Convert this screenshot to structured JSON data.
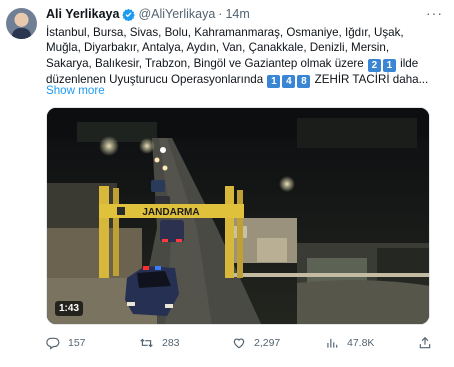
{
  "tweet": {
    "author_name": "Ali Yerlikaya",
    "handle": "@AliYerlikaya",
    "separator": "·",
    "time": "14m",
    "verified_icon": "verified-badge-icon",
    "lines": {
      "line1": "İstanbul, Bursa, Sivas, Bolu, Kahramanmaraş, Osmaniye, Iğdır, Uşak,",
      "line2": "Muğla, Diyarbakır, Antalya, Aydın, Van, Çanakkale, Denizli, Mersin,",
      "line3_pre": "Sakarya, Balıkesir, Trabzon, Bingöl ve Gaziantep  olmak üzere ",
      "line3_box1": "2",
      "line3_box2": "1",
      "line3_post": " ilde",
      "line4_pre": "düzenlenen Uyuşturucu Operasyonlarında ",
      "line4_box1": "1",
      "line4_box2": "4",
      "line4_box3": "8",
      "line4_post": " ZEHİR TACİRİ daha..."
    },
    "show_more": "Show more"
  },
  "media": {
    "duration": "1:43",
    "gate_sign": "JANDARMA"
  },
  "actions": {
    "replies": "157",
    "retweets": "283",
    "likes": "2,297",
    "views": "47.8K"
  },
  "colors": {
    "link": "#1d9bf0",
    "muted": "#536471",
    "verified": "#1d9bf0",
    "keycap": "#3a86d4"
  }
}
